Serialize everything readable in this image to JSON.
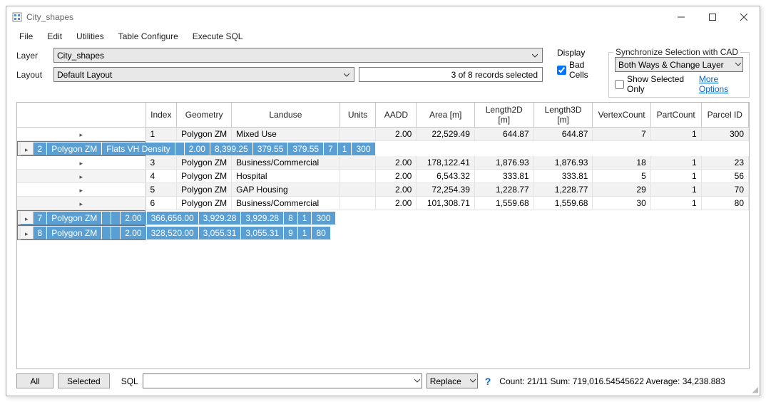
{
  "window": {
    "title": "City_shapes"
  },
  "menu": {
    "file": "File",
    "edit": "Edit",
    "utilities": "Utilities",
    "table_configure": "Table Configure",
    "execute_sql": "Execute SQL"
  },
  "layer": {
    "label": "Layer",
    "value": "City_shapes"
  },
  "layout": {
    "label": "Layout",
    "value": "Default Layout"
  },
  "selection_status": "3 of 8 records selected",
  "display": {
    "title": "Display",
    "bad_cells_label": "Bad Cells",
    "bad_cells_checked": true
  },
  "sync": {
    "title": "Synchronize Selection with CAD",
    "mode": "Both Ways & Change Layer",
    "show_selected_only_label": "Show Selected Only",
    "show_selected_only_checked": false,
    "more_options": "More Options"
  },
  "columns": [
    "",
    "Index",
    "Geometry",
    "Landuse",
    "Units",
    "AADD",
    "Area [m]",
    "Length2D [m]",
    "Length3D [m]",
    "VertexCount",
    "PartCount",
    "Parcel ID"
  ],
  "rows": [
    {
      "sel": false,
      "idx": "1",
      "geom": "Polygon ZM",
      "landuse": "Mixed Use",
      "units": "",
      "aadd": "2.00",
      "area": "22,529.49",
      "l2d": "644.87",
      "l3d": "644.87",
      "vc": "7",
      "pc": "1",
      "pid": "300"
    },
    {
      "sel": true,
      "idx": "2",
      "geom": "Polygon ZM",
      "landuse": "Flats VH Density",
      "units": "",
      "aadd": "2.00",
      "area": "8,399.25",
      "l2d": "379.55",
      "l3d": "379.55",
      "vc": "7",
      "pc": "1",
      "pid": "300"
    },
    {
      "sel": false,
      "idx": "3",
      "geom": "Polygon ZM",
      "landuse": "Business/Commercial",
      "units": "",
      "aadd": "2.00",
      "area": "178,122.41",
      "l2d": "1,876.93",
      "l3d": "1,876.93",
      "vc": "18",
      "pc": "1",
      "pid": "23"
    },
    {
      "sel": false,
      "idx": "4",
      "geom": "Polygon ZM",
      "landuse": "Hospital",
      "units": "",
      "aadd": "2.00",
      "area": "6,543.32",
      "l2d": "333.81",
      "l3d": "333.81",
      "vc": "5",
      "pc": "1",
      "pid": "56"
    },
    {
      "sel": false,
      "idx": "5",
      "geom": "Polygon ZM",
      "landuse": "GAP Housing",
      "units": "",
      "aadd": "2.00",
      "area": "72,254.39",
      "l2d": "1,228.77",
      "l3d": "1,228.77",
      "vc": "29",
      "pc": "1",
      "pid": "70"
    },
    {
      "sel": false,
      "idx": "6",
      "geom": "Polygon ZM",
      "landuse": "Business/Commercial",
      "units": "",
      "aadd": "2.00",
      "area": "101,308.71",
      "l2d": "1,559.68",
      "l3d": "1,559.68",
      "vc": "30",
      "pc": "1",
      "pid": "80"
    },
    {
      "sel": true,
      "idx": "7",
      "geom": "Polygon ZM",
      "landuse": "",
      "units": "",
      "aadd": "2.00",
      "area": "366,656.00",
      "l2d": "3,929.28",
      "l3d": "3,929.28",
      "vc": "8",
      "pc": "1",
      "pid": "300"
    },
    {
      "sel": true,
      "idx": "8",
      "geom": "Polygon ZM",
      "landuse": "",
      "units": "",
      "aadd": "2.00",
      "area": "328,520.00",
      "l2d": "3,055.31",
      "l3d": "3,055.31",
      "vc": "9",
      "pc": "1",
      "pid": "80"
    }
  ],
  "footer": {
    "all": "All",
    "selected": "Selected",
    "sql_label": "SQL",
    "sql_value": "",
    "replace": "Replace",
    "stats": "Count: 21/11   Sum: 719,016.54545622   Average: 34,238.883"
  }
}
